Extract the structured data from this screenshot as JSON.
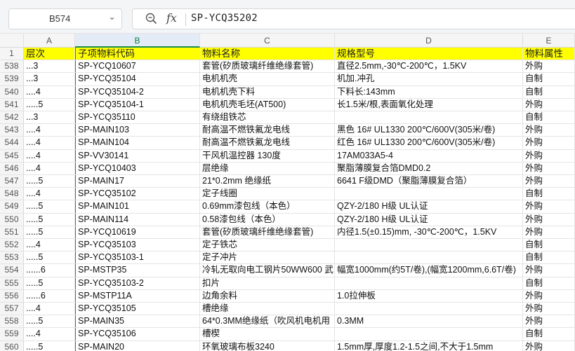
{
  "formula_bar": {
    "name_box": "B574",
    "fx_label": "fx",
    "formula": "SP-YCQ35202"
  },
  "columns": [
    "A",
    "B",
    "C",
    "D",
    "E"
  ],
  "header_row": {
    "num": "1",
    "cells": [
      "层次",
      "子项物料代码",
      "物料名称",
      "规格型号",
      "物料属性"
    ]
  },
  "rows": [
    {
      "num": "538",
      "cells": [
        "...3",
        "SP-YCQ10607",
        "套管(矽质玻璃纤维绝缘套管)",
        "直径2.5mm,-30℃-200℃，1.5KV",
        "外购"
      ]
    },
    {
      "num": "539",
      "cells": [
        "...3",
        "SP-YCQ35104",
        "电机机壳",
        "机加.冲孔",
        "自制"
      ]
    },
    {
      "num": "540",
      "cells": [
        "....4",
        "SP-YCQ35104-2",
        "电机机壳下料",
        "下料长:143mm",
        "自制"
      ]
    },
    {
      "num": "541",
      "cells": [
        ".....5",
        "SP-YCQ35104-1",
        "电机机壳毛坯(AT500)",
        "长1.5米/根,表面氧化处理",
        "外购"
      ]
    },
    {
      "num": "542",
      "cells": [
        "...3",
        "SP-YCQ35110",
        "有绕组铁芯",
        "",
        "自制"
      ]
    },
    {
      "num": "543",
      "cells": [
        "....4",
        "SP-MAIN103",
        "耐高温不燃铁氟龙电线",
        "黑色 16# UL1330 200℃/600V(305米/卷)",
        "外购"
      ]
    },
    {
      "num": "544",
      "cells": [
        "....4",
        "SP-MAIN104",
        "耐高温不燃铁氟龙电线",
        "红色 16# UL1330 200℃/600V(305米/卷)",
        "外购"
      ]
    },
    {
      "num": "545",
      "cells": [
        "....4",
        "SP-VV30141",
        "干风机温控器 130度",
        "17AM033A5-4",
        "外购"
      ]
    },
    {
      "num": "546",
      "cells": [
        "....4",
        "SP-YCQ10403",
        "层绝缘",
        "聚脂薄膜复合箔DMD0.2",
        "外购"
      ]
    },
    {
      "num": "547",
      "cells": [
        ".....5",
        "SP-MAIN17",
        "21*0.2mm 绝缘纸",
        "6641 F级DMD（聚脂薄膜复合箔）",
        "外购"
      ]
    },
    {
      "num": "548",
      "cells": [
        "....4",
        "SP-YCQ35102",
        "定子线圈",
        "",
        "自制"
      ]
    },
    {
      "num": "549",
      "cells": [
        ".....5",
        "SP-MAIN101",
        "0.69mm漆包线（本色）",
        "QZY-2/180 H级 UL认证",
        "外购"
      ]
    },
    {
      "num": "550",
      "cells": [
        ".....5",
        "SP-MAIN114",
        "0.58漆包线（本色）",
        "QZY-2/180 H级 UL认证",
        "外购"
      ]
    },
    {
      "num": "551",
      "cells": [
        ".....5",
        "SP-YCQ10619",
        "套管(矽质玻璃纤维绝缘套管)",
        "内径1.5(±0.15)mm, -30℃-200℃，1.5KV",
        "外购"
      ]
    },
    {
      "num": "552",
      "cells": [
        "....4",
        "SP-YCQ35103",
        "定子铁芯",
        "",
        "自制"
      ]
    },
    {
      "num": "553",
      "cells": [
        ".....5",
        "SP-YCQ35103-1",
        "定子冲片",
        "",
        "自制"
      ]
    },
    {
      "num": "554",
      "cells": [
        "......6",
        "SP-MSTP35",
        "冷轧无取向电工钢片50WW600 武",
        "幅宽1000mm(约5T/卷),(幅宽1200mm,6.6T/卷)",
        "外购"
      ]
    },
    {
      "num": "555",
      "cells": [
        ".....5",
        "SP-YCQ35103-2",
        "扣片",
        "",
        "自制"
      ]
    },
    {
      "num": "556",
      "cells": [
        "......6",
        "SP-MSTP11A",
        "边角余料",
        "1.0拉伸板",
        "外购"
      ]
    },
    {
      "num": "557",
      "cells": [
        "....4",
        "SP-YCQ35105",
        "槽绝缘",
        "",
        "外购"
      ]
    },
    {
      "num": "558",
      "cells": [
        ".....5",
        "SP-MAIN35",
        "64*0.3MM绝缘纸（吹风机电机用",
        "0.3MM",
        "外购"
      ]
    },
    {
      "num": "559",
      "cells": [
        "....4",
        "SP-YCQ35106",
        "槽楔",
        "",
        "自制"
      ]
    },
    {
      "num": "560",
      "cells": [
        ".....5",
        "SP-MAIN20",
        "环氧玻璃布板3240",
        "1.5mm厚,厚度1.2-1.5之间,不大于1.5mm",
        "外购"
      ]
    }
  ]
}
